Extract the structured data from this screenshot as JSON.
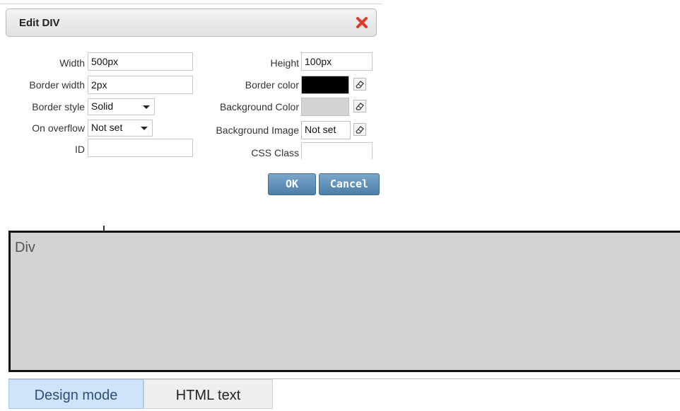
{
  "dialog": {
    "title": "Edit DIV",
    "fields": {
      "width": {
        "label": "Width",
        "value": "500px"
      },
      "height": {
        "label": "Height",
        "value": "100px"
      },
      "border_width": {
        "label": "Border width",
        "value": "2px"
      },
      "border_color": {
        "label": "Border color",
        "color": "#000000"
      },
      "border_style": {
        "label": "Border style",
        "value": "Solid"
      },
      "background_color": {
        "label": "Background Color",
        "color": "#d3d3d3"
      },
      "on_overflow": {
        "label": "On overflow",
        "value": "Not set"
      },
      "background_image": {
        "label": "Background Image",
        "value": "Not set"
      },
      "id": {
        "label": "ID",
        "value": ""
      },
      "css_class": {
        "label": "CSS Class",
        "value": ""
      }
    },
    "ok_label": "OK",
    "cancel_label": "Cancel",
    "icons": {
      "close": "close-icon",
      "clear": "eraser-icon"
    }
  },
  "editor": {
    "div_text": "Div",
    "div_background": "#d3d3d3",
    "tabs": [
      {
        "label": "Design mode",
        "active": true
      },
      {
        "label": "HTML text",
        "active": false
      }
    ]
  }
}
